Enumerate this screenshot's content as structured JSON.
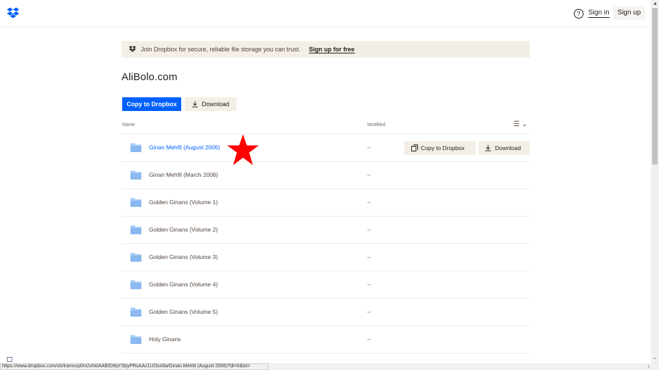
{
  "header": {
    "help_icon": "?",
    "sign_in": "Sign in",
    "sign_up": "Sign up"
  },
  "banner": {
    "text": "Join Dropbox for secure, reliable file storage you can trust.",
    "link": "Sign up for free"
  },
  "page": {
    "title": "AliBolo.com",
    "copy_button": "Copy to Dropbox",
    "download_button": "Download"
  },
  "table": {
    "col_name": "Name",
    "col_modified": "Modified",
    "view_icon": "☰ ⌄",
    "rows": [
      {
        "name": "Ginan Mehfil (August 2006)",
        "modified": "–"
      },
      {
        "name": "Ginan Mehfil (March 2006)",
        "modified": "–"
      },
      {
        "name": "Golden Ginans (Volume 1)",
        "modified": "–"
      },
      {
        "name": "Golden Ginans (Volume 2)",
        "modified": "–"
      },
      {
        "name": "Golden Ginans (Volume 3)",
        "modified": "–"
      },
      {
        "name": "Golden Ginans (Volume 4)",
        "modified": "–"
      },
      {
        "name": "Golden Ginans (Volume 5)",
        "modified": "–"
      },
      {
        "name": "Holy Ginans",
        "modified": "–"
      }
    ],
    "row_copy_button": "Copy to Dropbox",
    "row_download_button": "Download"
  },
  "statusbar": {
    "url": "https://www.dropbox.com/sh/lramvcp0ni2xhit/AABIDIfqYSbyPRsAAz1UOsn8a/Ginan Mehfil (August 2006)?dl=0&lst="
  },
  "colors": {
    "primary": "#0061fe",
    "banner_bg": "#f4efe6",
    "folder": "#a8cbf5",
    "star": "#ff0000"
  }
}
